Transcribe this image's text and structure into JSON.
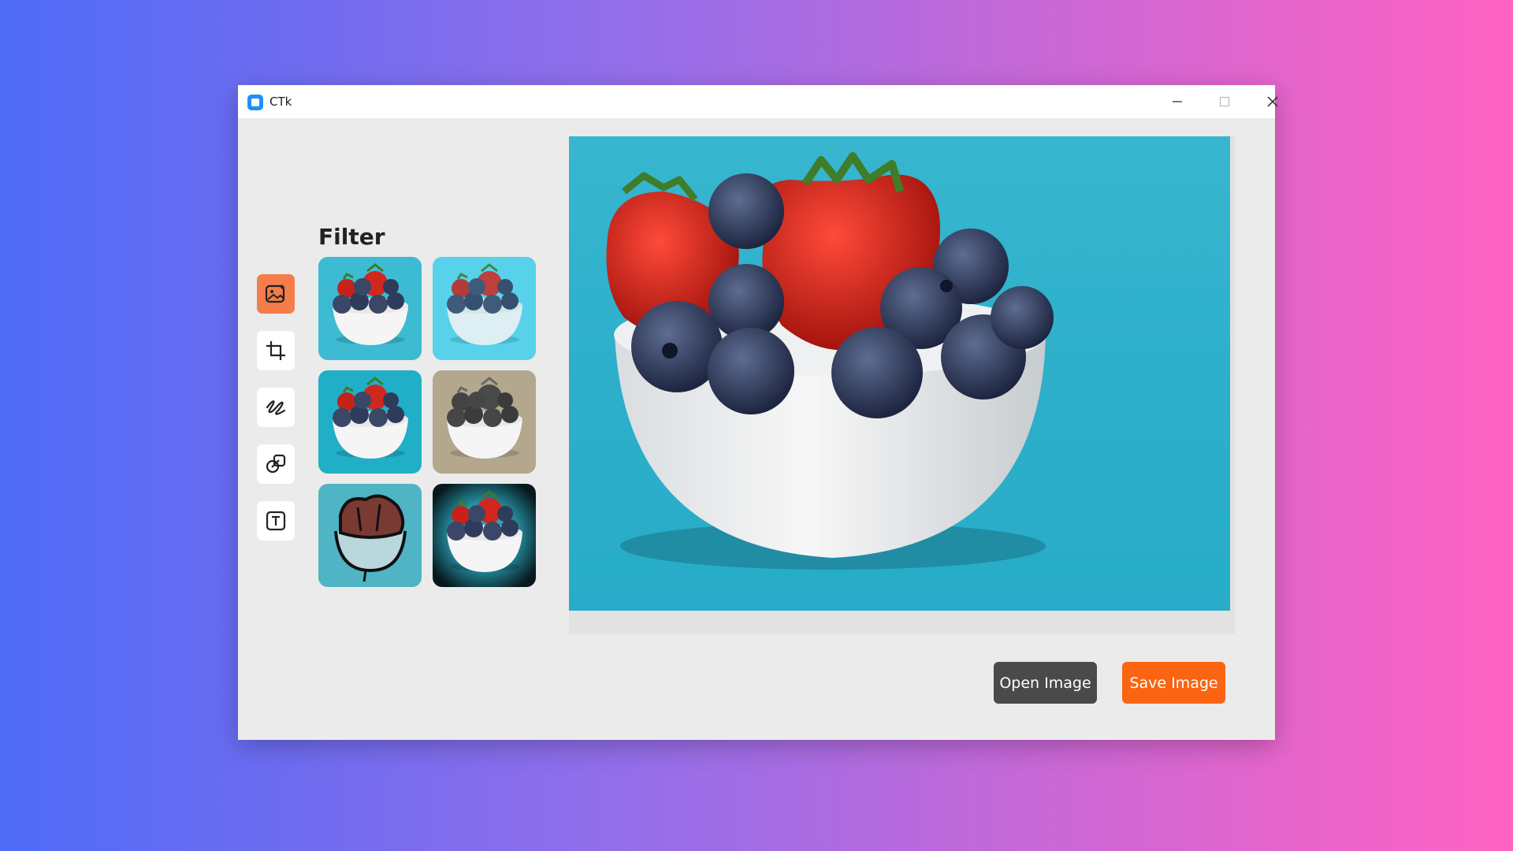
{
  "window": {
    "title": "CTk"
  },
  "sidebar": {
    "tools": [
      {
        "name": "filter",
        "icon": "image-sparkle-icon",
        "active": true
      },
      {
        "name": "crop",
        "icon": "crop-icon",
        "active": false
      },
      {
        "name": "draw",
        "icon": "draw-icon",
        "active": false
      },
      {
        "name": "adjust",
        "icon": "adjust-icon",
        "active": false
      },
      {
        "name": "text",
        "icon": "text-icon",
        "active": false
      }
    ]
  },
  "filter_panel": {
    "title": "Filter",
    "thumbnails": [
      "original",
      "brighten",
      "contrast",
      "sepia-grayscale",
      "contour",
      "vignette"
    ]
  },
  "actions": {
    "open_label": "Open Image",
    "save_label": "Save Image"
  },
  "colors": {
    "accent": "#f57d4a",
    "save": "#fa6412",
    "open": "#4a4a4a"
  }
}
